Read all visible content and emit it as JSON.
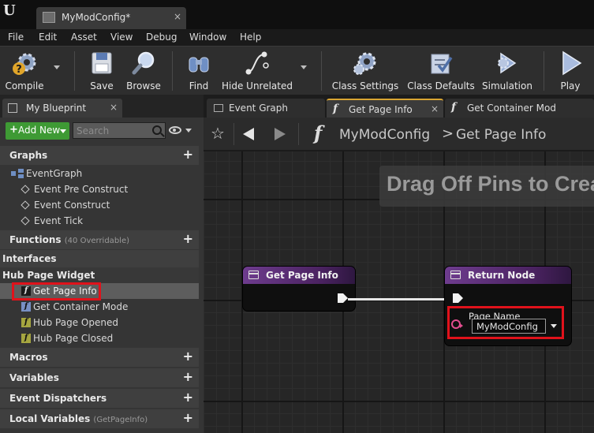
{
  "window": {
    "tab_title": "MyModConfig*",
    "close_glyph": "×"
  },
  "menu": [
    "File",
    "Edit",
    "Asset",
    "View",
    "Debug",
    "Window",
    "Help"
  ],
  "toolbar": {
    "compile": "Compile",
    "save": "Save",
    "browse": "Browse",
    "find": "Find",
    "hide_unrelated": "Hide Unrelated",
    "class_settings": "Class Settings",
    "class_defaults": "Class Defaults",
    "simulation": "Simulation",
    "play": "Play"
  },
  "my_blueprint": {
    "tab_label": "My Blueprint",
    "add_new": "Add New",
    "search_placeholder": "Search",
    "sections": {
      "graphs": "Graphs",
      "functions": "Functions",
      "functions_sub": "(40 Overridable)",
      "interfaces": "Interfaces",
      "hub_page_widget": "Hub Page Widget",
      "macros": "Macros",
      "variables": "Variables",
      "event_dispatchers": "Event Dispatchers",
      "local_variables": "Local Variables",
      "local_variables_sub": "(GetPageInfo)"
    },
    "event_graph": "EventGraph",
    "events": [
      "Event Pre Construct",
      "Event Construct",
      "Event Tick"
    ],
    "hub_functions": [
      "Get Page Info",
      "Get Container Mode",
      "Hub Page Opened",
      "Hub Page Closed"
    ]
  },
  "graph_tabs": [
    "Event Graph",
    "Get Page Info",
    "Get Container Mod"
  ],
  "breadcrumb": {
    "root": "MyModConfig",
    "separator": ">",
    "current": "Get Page Info"
  },
  "graph": {
    "hint": "Drag Off Pins to Crea",
    "entry_node_title": "Get Page Info",
    "return_node_title": "Return Node",
    "pin_label": "Page Name",
    "pin_value": "MyModConfig"
  },
  "colors": {
    "add_new_green": "#3e9a34",
    "highlight_red": "#e0121b",
    "node_header_purple": "#6e3c8e",
    "string_pin_pink": "#e34d8f",
    "active_tab_accent": "#d9a532"
  }
}
